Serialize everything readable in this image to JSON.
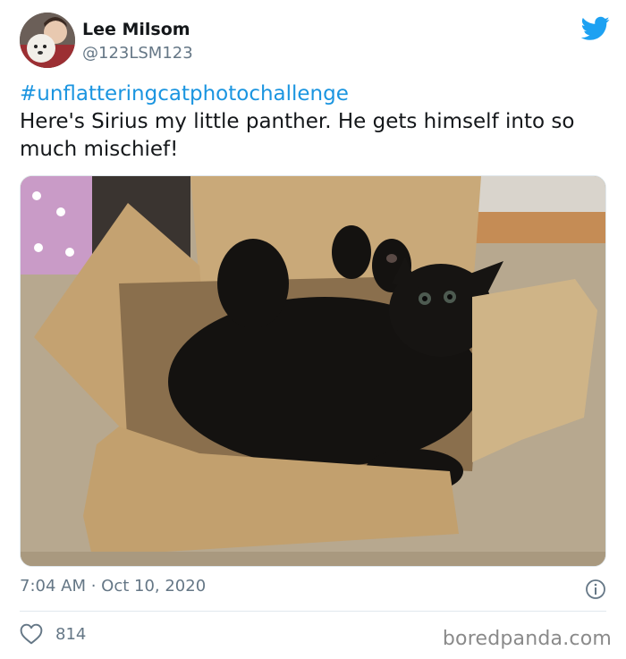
{
  "tweet": {
    "author": {
      "name": "Lee Milsom",
      "handle": "@123LSM123"
    },
    "hashtag": "#unflatteringcatphotochallenge",
    "text": "Here's Sirius my little panther. He gets himself into so much mischief!",
    "timestamp": "7:04 AM · Oct 10, 2020",
    "likes": "814"
  },
  "watermark": "boredpanda.com",
  "colors": {
    "link": "#1b95e0",
    "twitter_blue": "#1da1f2",
    "secondary_text": "#657786",
    "divider": "#e1e8ed"
  },
  "icons": {
    "brand": "twitter-bird-icon",
    "info": "info-icon",
    "like": "heart-outline-icon"
  }
}
